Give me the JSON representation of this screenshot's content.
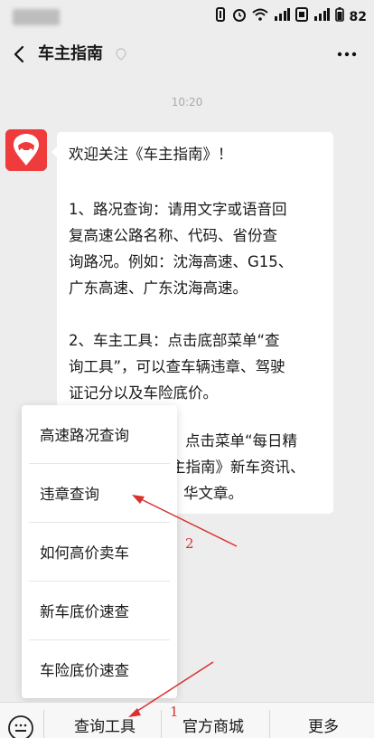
{
  "status_bar": {
    "battery": "82"
  },
  "header": {
    "title": "车主指南"
  },
  "chat": {
    "timestamp": "10:20",
    "message_lines": [
      "欢迎关注《车主指南》！",
      "",
      "1、路况查询：请用文字或语音回",
      "复高速公路名称、代码、省份查",
      "询路况。例如：沈海高速、G15、",
      "广东高速、广东沈海高速。",
      "",
      "2、车主工具：点击底部菜单“查",
      "询工具”，可以查车辆违章、驾驶",
      "证记分以及车险底价。",
      "",
      "点击菜单“每日精",
      "主指南》新车资讯、",
      "华文章。"
    ]
  },
  "popup_menu": {
    "items": [
      "高速路况查询",
      "违章查询",
      "如何高价卖车",
      "新车底价速查",
      "车险底价速查"
    ]
  },
  "bottom_bar": {
    "tabs": [
      "查询工具",
      "官方商城",
      "更多"
    ]
  },
  "annotations": {
    "label_1": "1",
    "label_2": "2",
    "color": "#d8312f"
  },
  "colors": {
    "avatar": "#ef3b3b",
    "background": "#ededed"
  }
}
